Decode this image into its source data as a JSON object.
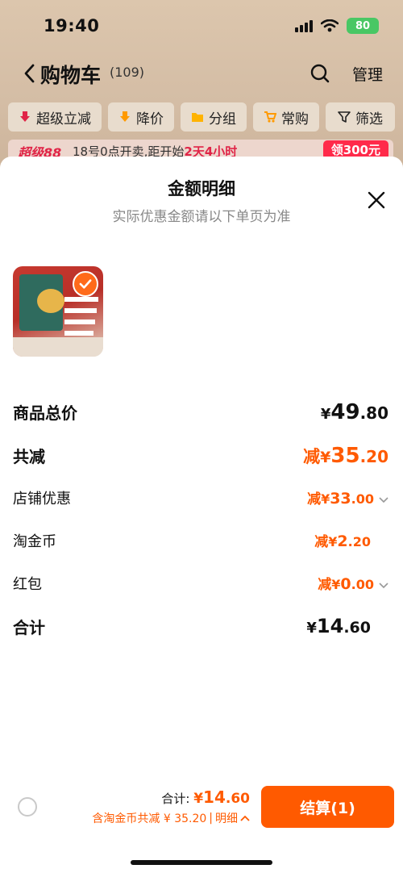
{
  "status_bar": {
    "time": "19:40",
    "battery": "80"
  },
  "nav": {
    "title": "购物车",
    "count": "(109)",
    "manage": "管理"
  },
  "filters": [
    {
      "label": "超级立减",
      "icon": "down-arrow-icon"
    },
    {
      "label": "降价",
      "icon": "price-drop-icon"
    },
    {
      "label": "分组",
      "icon": "folder-icon"
    },
    {
      "label": "常购",
      "icon": "cart-icon"
    },
    {
      "label": "筛选",
      "icon": "filter-icon"
    }
  ],
  "promo": {
    "brand": "超级88",
    "text_before": "18号0点开卖,距开始",
    "countdown": "2天4小时",
    "coupon": "领300元"
  },
  "sheet": {
    "title": "金额明细",
    "subtitle": "实际优惠金额请以下单页为准",
    "rows": [
      {
        "label": "商品总价",
        "prefix": "",
        "currency": "¥",
        "integer": "49",
        "decimal": ".80"
      },
      {
        "label": "共减",
        "prefix": "减",
        "currency": "¥",
        "integer": "35",
        "decimal": ".20"
      },
      {
        "label": "店铺优惠",
        "prefix": "减",
        "currency": "¥",
        "integer": "33",
        "decimal": ".00"
      },
      {
        "label": "淘金币",
        "prefix": "减",
        "currency": "¥",
        "integer": "2",
        "decimal": ".20"
      },
      {
        "label": "红包",
        "prefix": "减",
        "currency": "¥",
        "integer": "0",
        "decimal": ".00"
      },
      {
        "label": "合计",
        "prefix": "",
        "currency": "¥",
        "integer": "14",
        "decimal": ".60"
      }
    ]
  },
  "bottom": {
    "total_label": "合计:",
    "total_currency": "¥",
    "total_integer": "14",
    "total_decimal": ".60",
    "saved_text": "含淘金币共减 ¥ 35.20",
    "detail_label": "明细",
    "checkout": "结算(1)"
  },
  "colors": {
    "accent": "#ff5a00",
    "promo_red": "#e02447",
    "check_gray": "#c9c9c9"
  }
}
